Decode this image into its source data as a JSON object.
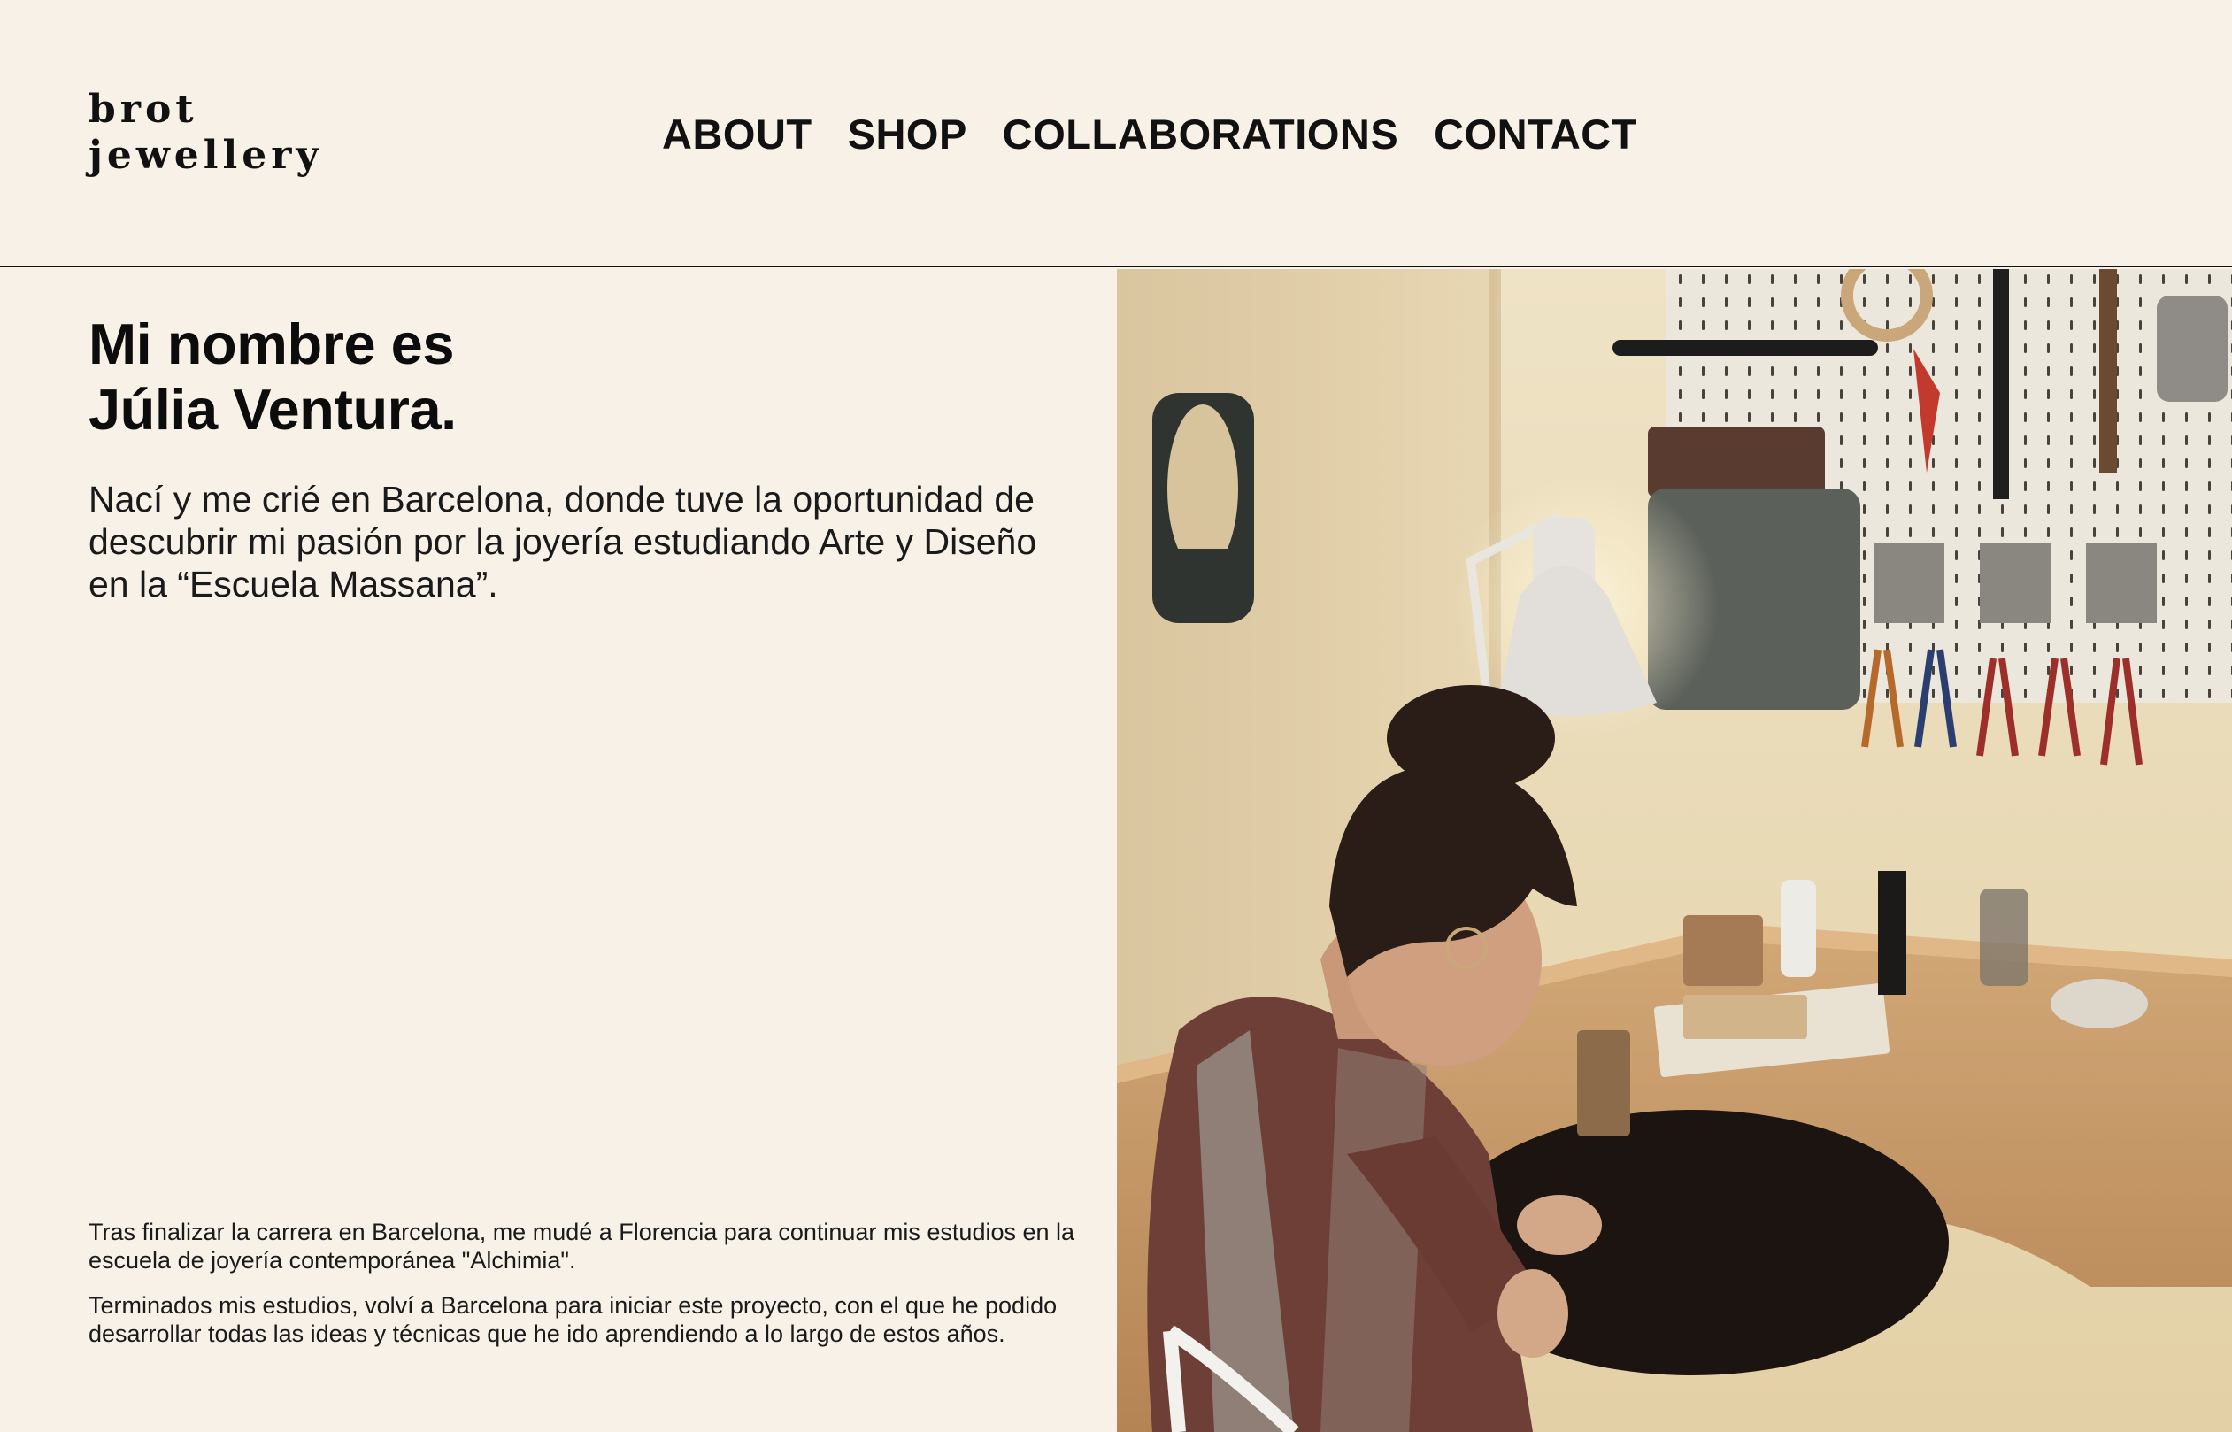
{
  "header": {
    "logo_line1": "brot",
    "logo_line2": "jewellery",
    "nav": [
      {
        "label": "ABOUT"
      },
      {
        "label": "SHOP"
      },
      {
        "label": "COLLABORATIONS"
      },
      {
        "label": "CONTACT"
      }
    ]
  },
  "intro": {
    "title_line1": "Mi nombre es",
    "title_line2": "Júlia Ventura.",
    "lead": "Nací y me crié en Barcelona, donde tuve la oportunidad de descubrir mi pasión por la joyería estudiando Arte y Diseño en la “Escuela Massana”."
  },
  "bio": {
    "paragraphs": [
      "Tras finalizar la carrera en Barcelona, me mudé a Florencia para continuar mis estudios en la escuela de joyería contemporánea \"Alchimia\".",
      "Terminados mis estudios, volví a Barcelona para iniciar este proyecto, con el que he podido desarrollar todas las ideas y técnicas que he ido aprendiendo a lo largo de estos años."
    ]
  },
  "photo": {
    "subject": "jeweller-at-workbench",
    "colors": {
      "background": "#f7f1e7",
      "wall": "#e4d3b0",
      "desk": "#c79a68",
      "shirt": "#6e3f36",
      "hair": "#2a1c16"
    }
  }
}
